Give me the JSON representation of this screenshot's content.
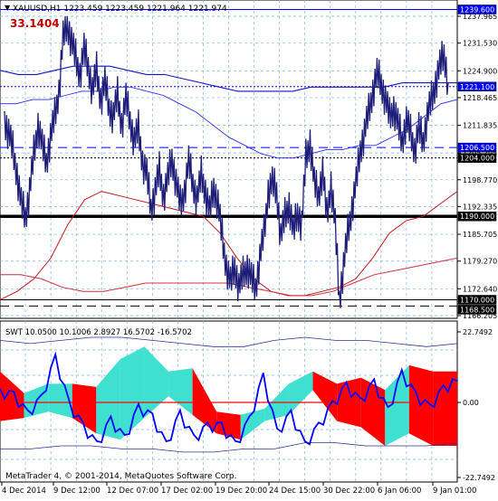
{
  "header": {
    "symbol_line": "XAUUSD,H1  1223.459 1223.459 1221.964 1221.974",
    "value_label": "33.1404"
  },
  "main": {
    "price_labels": [
      "1237.965",
      "1231.530",
      "1224.900",
      "1218.465",
      "1211.835",
      "1205.205",
      "1198.770",
      "1192.335",
      "1185.705",
      "1179.270",
      "1172.640",
      "1166.205"
    ],
    "hlines": [
      {
        "label": "1239.600",
        "color": "#0000ff",
        "style": "solid"
      },
      {
        "label": "1221.100",
        "color": "#0000ff",
        "style": "dotted"
      },
      {
        "label": "1206.500",
        "color": "#0000ff",
        "style": "dashed"
      },
      {
        "label": "1204.000",
        "color": "#000000",
        "style": "dotted"
      },
      {
        "label": "1190.000",
        "color": "#000000",
        "style": "thick"
      },
      {
        "label": "1170.000",
        "color": "#000000",
        "style": "solid"
      },
      {
        "label": "1168.500",
        "color": "#000000",
        "style": "dashed"
      }
    ]
  },
  "sub": {
    "title": "SWT 10.0500 10.1006 2.8927 16.5702 -16.5702",
    "labels": [
      "22.7492",
      "0.00",
      "-22.7492"
    ]
  },
  "footer": {
    "copyright": "MetaTrader 4, © 2001-2014, MetaQuotes Software Corp.",
    "time_labels": [
      "4 Dec 2014",
      "9 Dec 12:00",
      "12 Dec 07:00",
      "17 Dec 02:00",
      "19 Dec 20:00",
      "24 Dec 15:00",
      "30 Dec 22:00",
      "6 Jan 06:00",
      "9 Jan 01:00"
    ]
  },
  "chart_data": {
    "type": "line",
    "symbol": "XAUUSD",
    "timeframe": "H1",
    "price_axis": {
      "min": 1166.205,
      "max": 1237.965
    },
    "price_close": [
      1213,
      1210,
      1206,
      1200,
      1193,
      1190,
      1196,
      1205,
      1212,
      1207,
      1203,
      1209,
      1214,
      1220,
      1233,
      1236,
      1232,
      1228,
      1224,
      1230,
      1226,
      1220,
      1225,
      1218,
      1222,
      1216,
      1214,
      1219,
      1212,
      1218,
      1213,
      1208,
      1211,
      1203,
      1200,
      1192,
      1196,
      1201,
      1195,
      1199,
      1204,
      1198,
      1193,
      1196,
      1203,
      1198,
      1194,
      1200,
      1196,
      1191,
      1197,
      1193,
      1185,
      1178,
      1174,
      1178,
      1173,
      1176,
      1178,
      1175,
      1173,
      1180,
      1186,
      1196,
      1198,
      1196,
      1185,
      1190,
      1193,
      1186,
      1191,
      1188,
      1204,
      1208,
      1198,
      1195,
      1201,
      1190,
      1198,
      1188,
      1170,
      1178,
      1186,
      1192,
      1198,
      1206,
      1210,
      1215,
      1220,
      1224,
      1222,
      1218,
      1214,
      1216,
      1212,
      1208,
      1213,
      1210,
      1206,
      1211,
      1208,
      1214,
      1218,
      1222,
      1226,
      1229,
      1222
    ],
    "ma_blue_thin": [
      1217,
      1217,
      1218,
      1218,
      1219,
      1220,
      1220,
      1221,
      1221,
      1220,
      1219,
      1217,
      1215,
      1212,
      1209,
      1207,
      1205,
      1204,
      1204,
      1205,
      1206,
      1206,
      1207,
      1207,
      1209,
      1211,
      1214,
      1217,
      1218
    ],
    "ma_blue_thick": [
      1225,
      1224,
      1224,
      1225,
      1226,
      1226,
      1226,
      1225,
      1224,
      1224,
      1223,
      1222,
      1221,
      1220,
      1220,
      1220,
      1220,
      1221,
      1221,
      1221,
      1221,
      1221,
      1222,
      1222,
      1222,
      1222
    ],
    "ma_red_main": [
      1170,
      1172,
      1175,
      1180,
      1188,
      1194,
      1196,
      1195,
      1194,
      1193,
      1192,
      1191,
      1190,
      1186,
      1180,
      1175,
      1172,
      1171,
      1171,
      1172,
      1173,
      1175,
      1180,
      1186,
      1189,
      1190,
      1193,
      1196
    ],
    "ma_red_slow": [
      1176,
      1176,
      1175,
      1173,
      1172,
      1172,
      1173,
      1174,
      1174,
      1174,
      1174,
      1174,
      1173,
      1172,
      1171,
      1171,
      1172,
      1174,
      1176,
      1177,
      1178,
      1179,
      1180
    ],
    "osc_axis": {
      "min": -22.7492,
      "max": 22.7492
    },
    "osc_band_red": [
      10,
      -5,
      -3,
      6,
      -10,
      -12,
      -5,
      2,
      11,
      -3,
      -12,
      -6,
      -4,
      10,
      6,
      8,
      -14,
      12,
      10
    ],
    "osc_band_teal": [
      -6,
      3,
      6,
      -5,
      5,
      14,
      18,
      10,
      -4,
      -10,
      -4,
      -2,
      6,
      4,
      -6,
      -8,
      4,
      -10,
      -14
    ],
    "osc_line": [
      3,
      2,
      -4,
      1,
      14,
      -1,
      -8,
      -14,
      -6,
      -12,
      -2,
      -5,
      -14,
      -4,
      -12,
      -8,
      -8,
      -14,
      -6,
      8,
      -10,
      -4,
      -14,
      -8,
      -1,
      5,
      0,
      6,
      -3,
      9,
      2,
      -2,
      4,
      7
    ],
    "osc_bands": {
      "upper": [
        20,
        19,
        20,
        21,
        21,
        20,
        19,
        18,
        18,
        20,
        21,
        20,
        20,
        19,
        18,
        19
      ],
      "lower": [
        -15,
        -15,
        -14,
        -14,
        -15,
        -15,
        -16,
        -16,
        -15,
        -15,
        -13,
        -13,
        -14,
        -14,
        -14,
        -13
      ]
    }
  }
}
